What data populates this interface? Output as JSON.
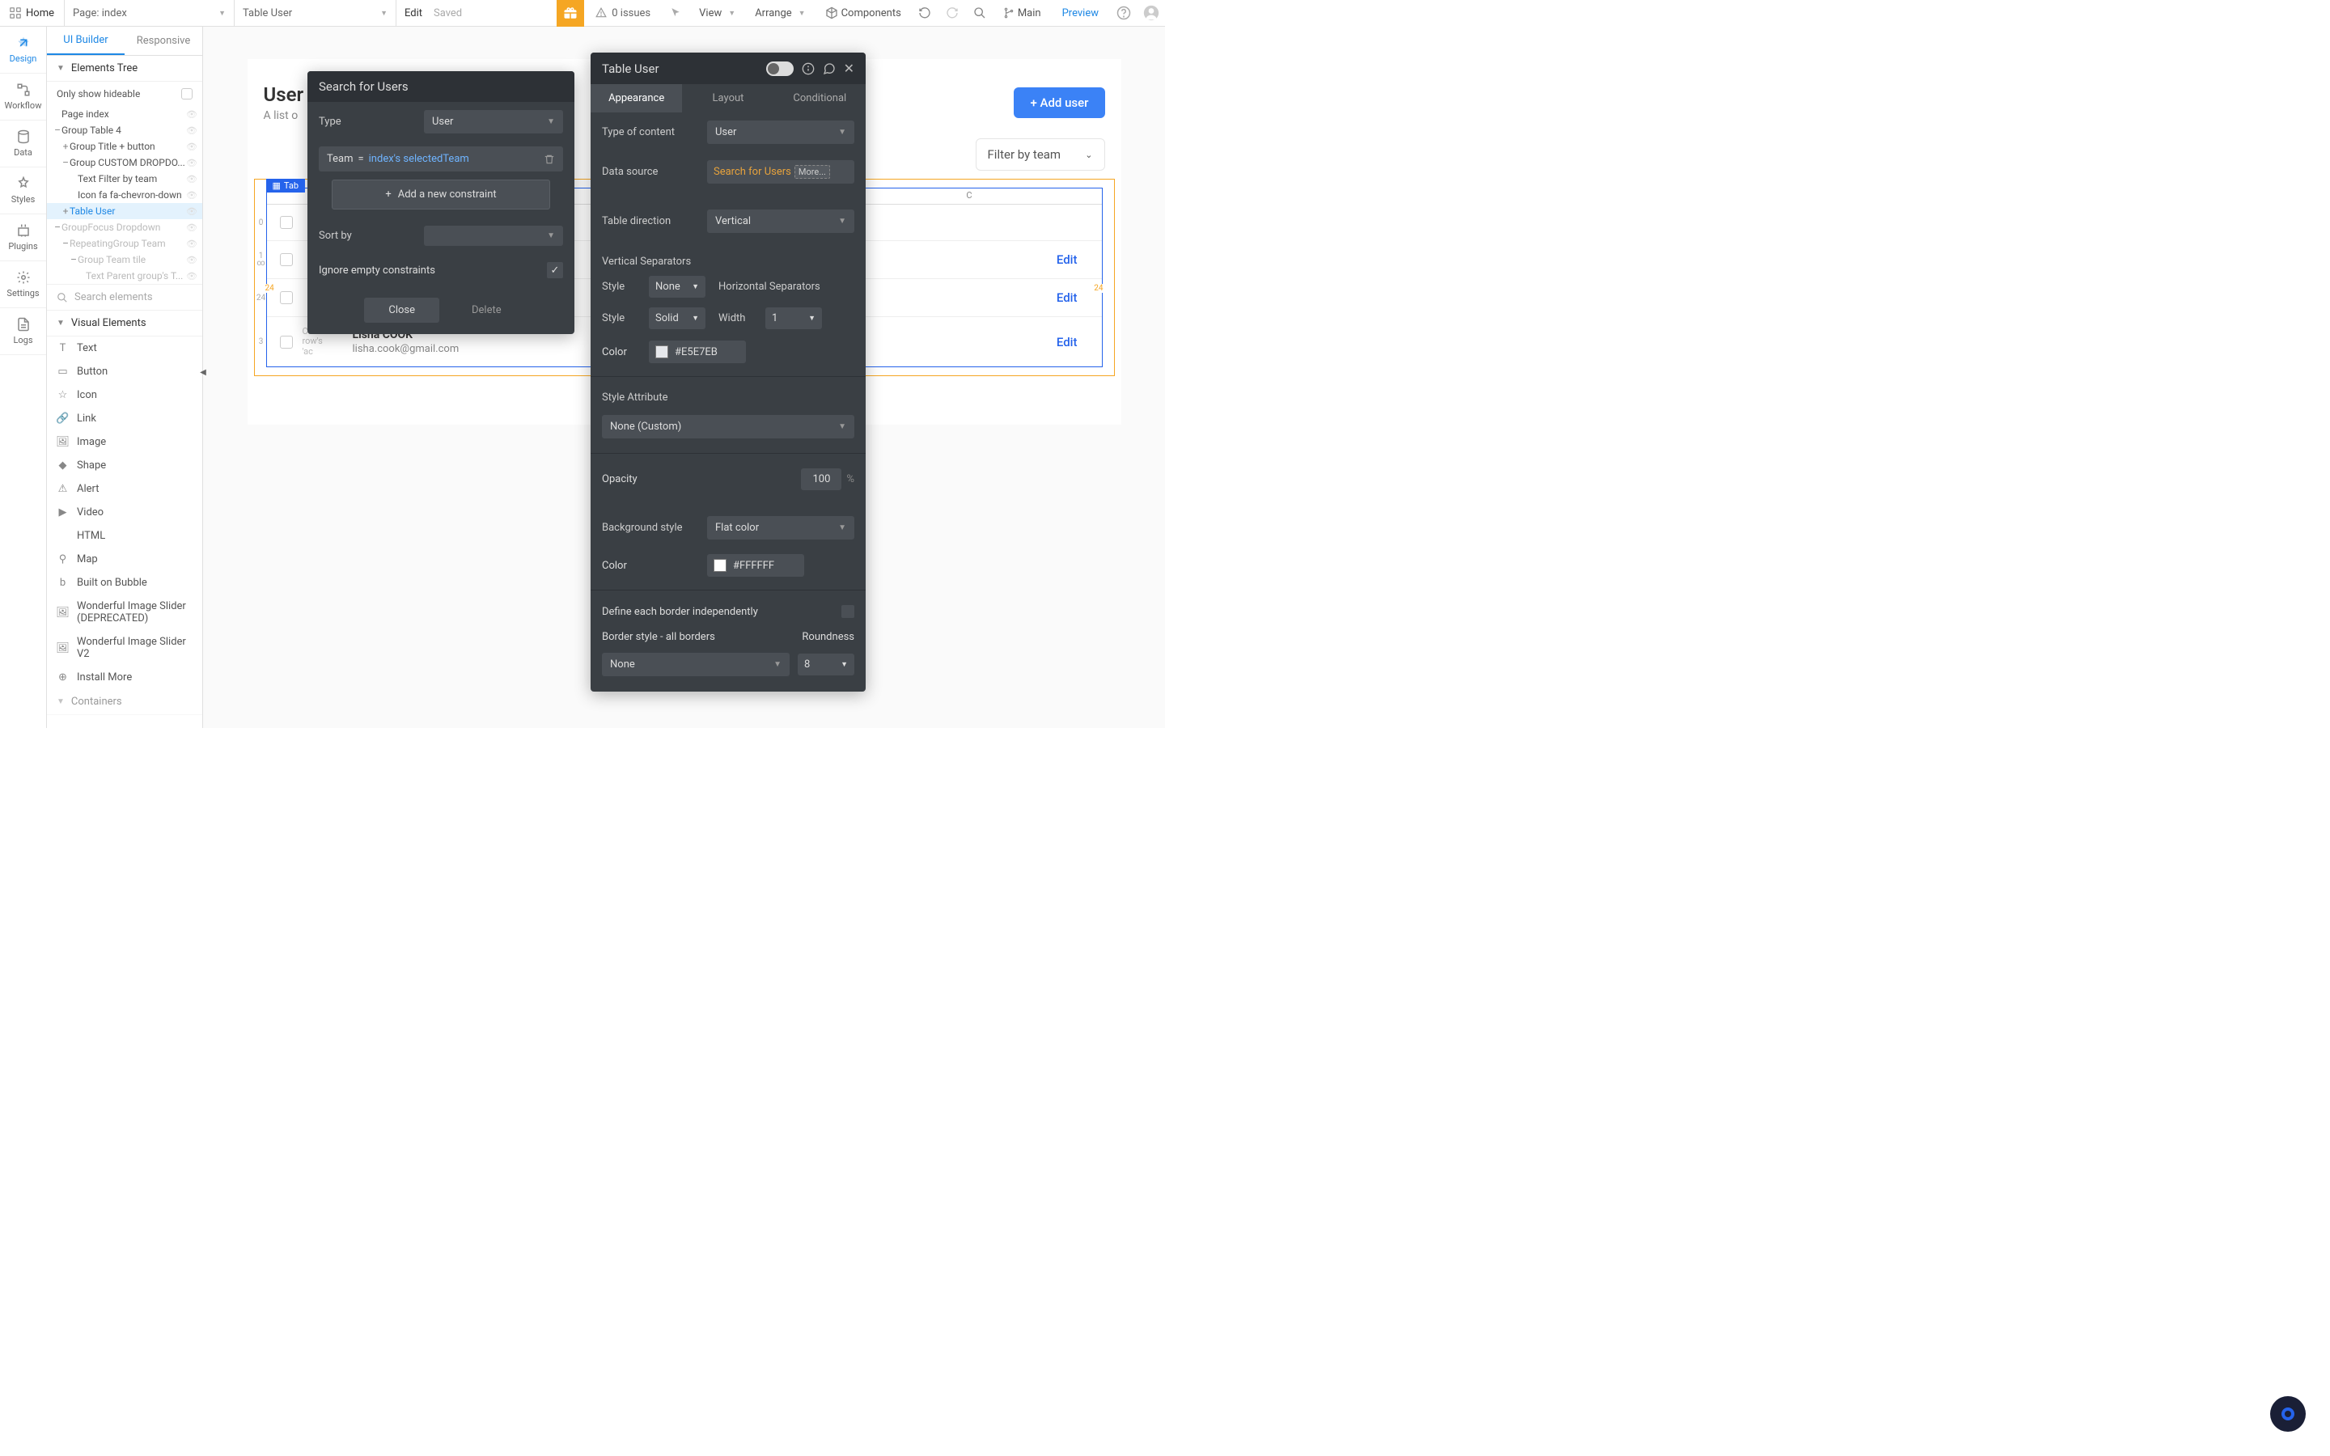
{
  "toolbar": {
    "home": "Home",
    "page_prefix": "Page:",
    "page_name": "index",
    "element_selected": "Table User",
    "edit": "Edit",
    "saved": "Saved",
    "issues": "0 issues",
    "view": "View",
    "arrange": "Arrange",
    "components": "Components",
    "main": "Main",
    "preview": "Preview"
  },
  "rail": {
    "design": "Design",
    "workflow": "Workflow",
    "data": "Data",
    "styles": "Styles",
    "plugins": "Plugins",
    "settings": "Settings",
    "logs": "Logs"
  },
  "left_panel": {
    "tab_ui": "UI Builder",
    "tab_resp": "Responsive",
    "elements_tree": "Elements Tree",
    "only_hideable": "Only show hideable",
    "tree": [
      {
        "label": "Page index",
        "indent": 0,
        "exp": ""
      },
      {
        "label": "Group Table 4",
        "indent": 0,
        "exp": "–"
      },
      {
        "label": "Group Title + button",
        "indent": 1,
        "exp": "+"
      },
      {
        "label": "Group CUSTOM DROPDO...",
        "indent": 1,
        "exp": "–"
      },
      {
        "label": "Text Filter by team",
        "indent": 2,
        "exp": ""
      },
      {
        "label": "Icon fa fa-chevron-down",
        "indent": 2,
        "exp": ""
      },
      {
        "label": "Table User",
        "indent": 1,
        "exp": "+",
        "selected": true
      },
      {
        "label": "GroupFocus Dropdown",
        "indent": 0,
        "exp": "–",
        "dim": true
      },
      {
        "label": "RepeatingGroup Team",
        "indent": 1,
        "exp": "–",
        "dim": true
      },
      {
        "label": "Group Team tile",
        "indent": 2,
        "exp": "–",
        "dim": true
      },
      {
        "label": "Text Parent group's T...",
        "indent": 3,
        "exp": "",
        "dim": true
      }
    ],
    "search_ph": "Search elements",
    "visual_elements": "Visual Elements",
    "ve_items": [
      "Text",
      "Button",
      "Icon",
      "Link",
      "Image",
      "Shape",
      "Alert",
      "Video",
      "HTML",
      "Map",
      "Built on Bubble",
      "Wonderful Image Slider (DEPRECATED)",
      "Wonderful Image Slider V2",
      "Install More"
    ],
    "containers": "Containers"
  },
  "canvas": {
    "title": "User",
    "subtitle": "A list o",
    "add_user": "+ Add user",
    "filter": "Filter by team",
    "table_tag": "Tab",
    "col_c": "C",
    "ruler": "24",
    "row0_idx": "0",
    "row1_idx": "1\n∞",
    "row2_idx": "2",
    "row3_idx": "3",
    "placeholder_cell": "Curre row's 'ac",
    "user_name": "Lisha COOK",
    "user_mail": "lisha.cook@gmail.com",
    "edit": "Edit"
  },
  "search_popup": {
    "title": "Search for Users",
    "type_lbl": "Type",
    "type_val": "User",
    "constraint_field": "Team",
    "constraint_op": "=",
    "constraint_val": "index's selectedTeam",
    "add_constraint": "Add a new constraint",
    "sort_by": "Sort by",
    "ignore_empty": "Ignore empty constraints",
    "close": "Close",
    "delete": "Delete"
  },
  "prop": {
    "title": "Table User",
    "tab_appearance": "Appearance",
    "tab_layout": "Layout",
    "tab_conditional": "Conditional",
    "type_of_content": "Type of content",
    "type_val": "User",
    "data_source": "Data source",
    "ds_val": "Search for Users",
    "ds_more": "More...",
    "table_direction": "Table direction",
    "direction_val": "Vertical",
    "vsep": "Vertical Separators",
    "hsep": "Horizontal Separators",
    "style_lbl": "Style",
    "vsep_style": "None",
    "hsep_style": "Solid",
    "width_lbl": "Width",
    "hsep_width": "1",
    "color_lbl": "Color",
    "hsep_color": "#E5E7EB",
    "style_attr": "Style Attribute",
    "style_attr_val": "None (Custom)",
    "opacity_lbl": "Opacity",
    "opacity_val": "100",
    "opacity_unit": "%",
    "bg_style": "Background style",
    "bg_style_val": "Flat color",
    "bg_color": "#FFFFFF",
    "define_borders": "Define each border independently",
    "border_style": "Border style - all borders",
    "border_val": "None",
    "roundness": "Roundness",
    "roundness_val": "8"
  }
}
